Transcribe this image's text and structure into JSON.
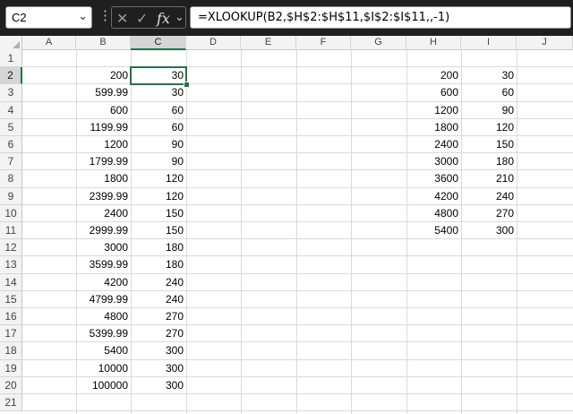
{
  "formula_bar": {
    "name_box": "C2",
    "formula": "=XLOOKUP(B2,$H$2:$H$11,$I$2:$I$11,,-1)",
    "cancel_glyph": "✕",
    "enter_glyph": "✓",
    "fx_glyph": "fx",
    "chevron_glyph": "⌄"
  },
  "columns": [
    "A",
    "B",
    "C",
    "D",
    "E",
    "F",
    "G",
    "H",
    "I",
    "J"
  ],
  "rows": [
    "1",
    "2",
    "3",
    "4",
    "5",
    "6",
    "7",
    "8",
    "9",
    "10",
    "11",
    "12",
    "13",
    "14",
    "15",
    "16",
    "17",
    "18",
    "19",
    "20",
    "21"
  ],
  "column_b": [
    "200",
    "599.99",
    "600",
    "1199.99",
    "1200",
    "1799.99",
    "1800",
    "2399.99",
    "2400",
    "2999.99",
    "3000",
    "3599.99",
    "4200",
    "4799.99",
    "4800",
    "5399.99",
    "5400",
    "10000",
    "100000"
  ],
  "column_c": [
    "30",
    "30",
    "60",
    "60",
    "90",
    "90",
    "120",
    "120",
    "150",
    "150",
    "180",
    "180",
    "240",
    "240",
    "270",
    "270",
    "300",
    "300",
    "300"
  ],
  "column_h": [
    "200",
    "600",
    "1200",
    "1800",
    "2400",
    "3000",
    "3600",
    "4200",
    "4800",
    "5400"
  ],
  "column_i": [
    "30",
    "60",
    "90",
    "120",
    "150",
    "180",
    "210",
    "240",
    "270",
    "300"
  ],
  "selected_cell": "C2",
  "accent_color": "#217346"
}
